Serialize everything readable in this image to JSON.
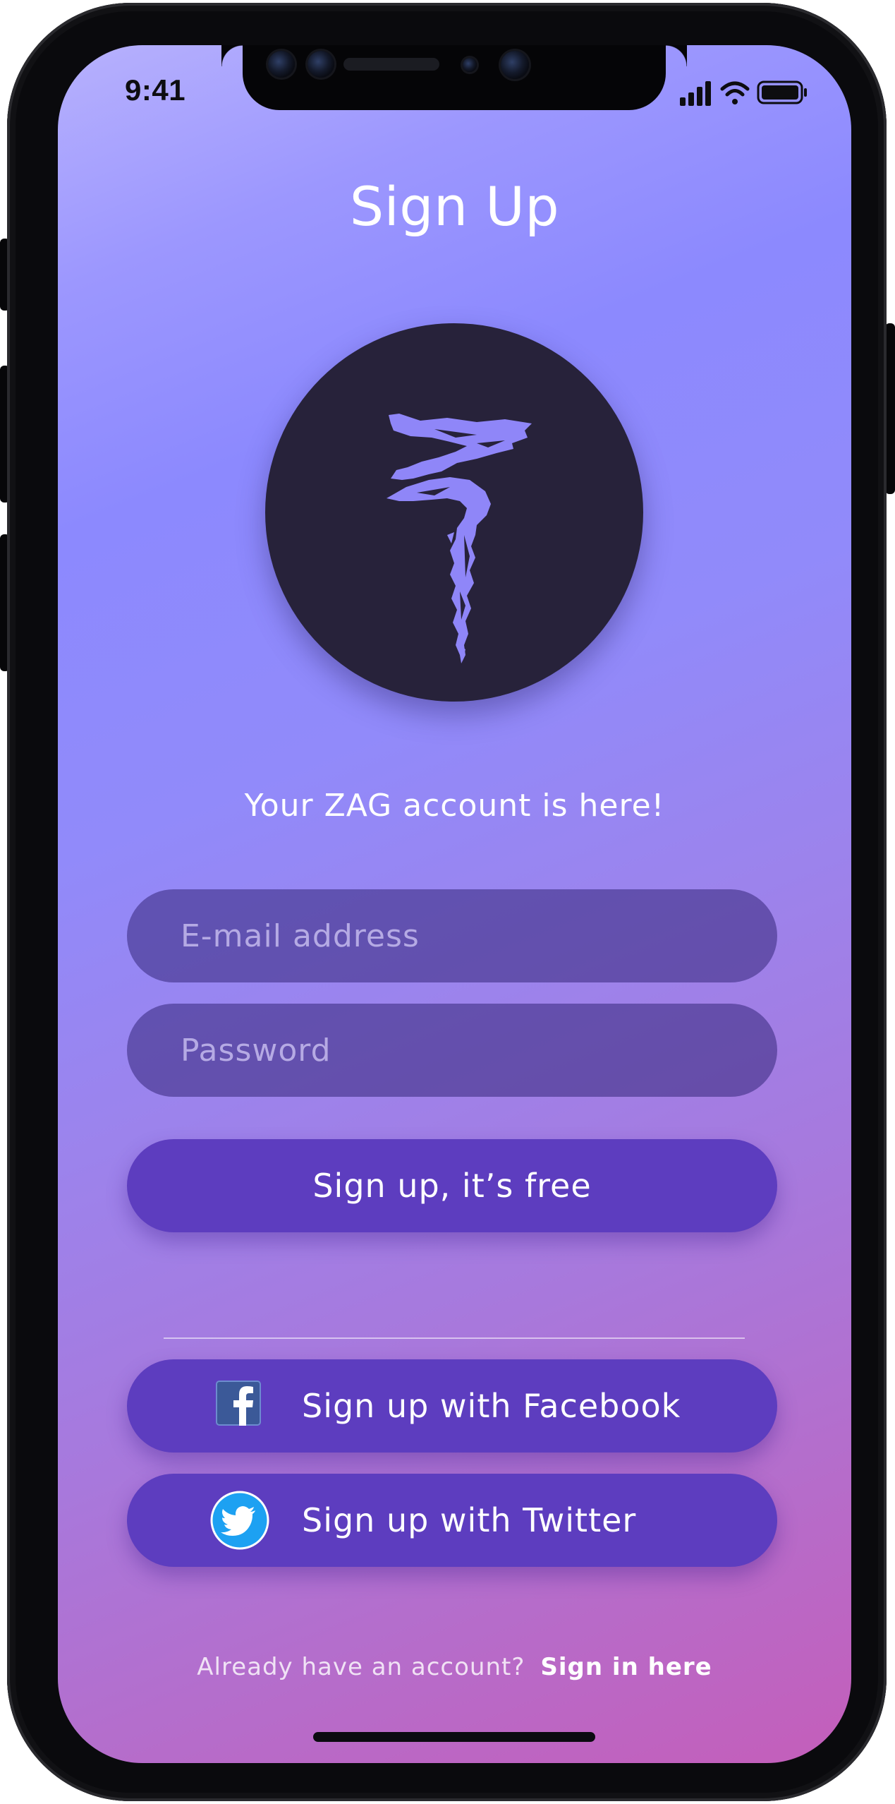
{
  "status_bar": {
    "time": "9:41"
  },
  "header": {
    "title": "Sign Up"
  },
  "logo": {
    "icon": "zag-brushstroke-logo"
  },
  "tagline": "Your ZAG account is here!",
  "form": {
    "email_placeholder": "E-mail address",
    "email_value": "",
    "password_placeholder": "Password",
    "password_value": "",
    "submit_label": "Sign up, it’s free"
  },
  "social": {
    "facebook_label": "Sign up with Facebook",
    "facebook_icon": "facebook-icon",
    "twitter_label": "Sign up with Twitter",
    "twitter_icon": "twitter-icon"
  },
  "footer": {
    "prompt": "Already have an account?",
    "link_label": "Sign in here"
  },
  "colors": {
    "primary_button": "#5d3dbf",
    "logo_background": "#27223a",
    "logo_accent": "#8f86f8",
    "gradient_start": "#b7b1fd",
    "gradient_end": "#c45eba",
    "facebook_blue": "#3b5998",
    "twitter_blue": "#1da1f2"
  }
}
